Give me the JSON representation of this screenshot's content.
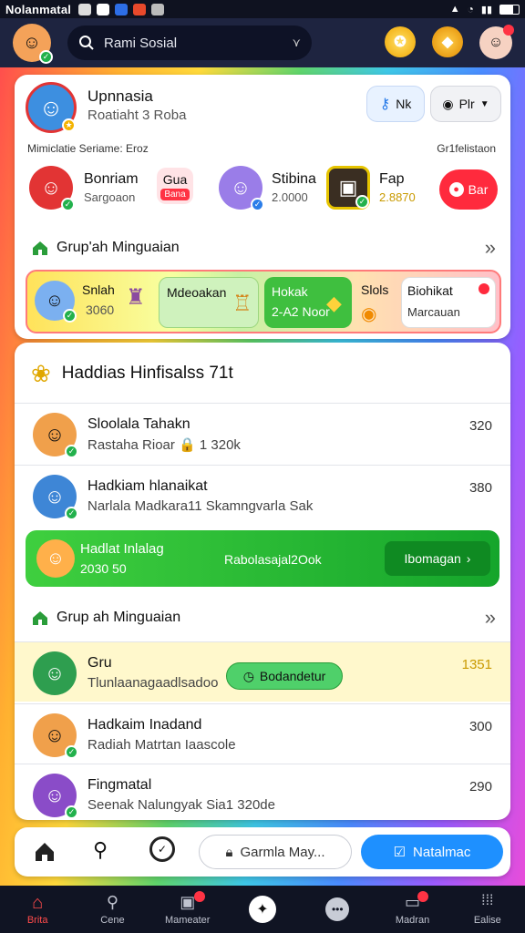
{
  "status_bar": {
    "carrier": "Nolanmatal"
  },
  "search": {
    "placeholder": "Rami Sosial"
  },
  "profile": {
    "name": "Upnnasia",
    "subtitle": "Roatiaht 3 Roba",
    "button1_label": "Nk",
    "button2_label": "Plr",
    "info_left": "Mimiclatie Seriame: Eroz",
    "info_right": "Gr1felistaon",
    "friends": [
      {
        "name": "Bonriam",
        "sub": "Sargoaon"
      },
      {
        "name": "Stibina",
        "sub": "2.0000"
      },
      {
        "name": "Fap",
        "sub": "2.8870"
      }
    ],
    "chip": {
      "label": "Gua",
      "tag": "Bana"
    },
    "red_pill_label": "Bar"
  },
  "section1": {
    "title": "Grup'ah Minguaian"
  },
  "promo": {
    "tiles": [
      {
        "title": "Snlah",
        "sub": "3060"
      },
      {
        "title": "Mdeoakan",
        "sub": ""
      },
      {
        "title": "Hokak",
        "sub": "2-A2 Noor"
      },
      {
        "title": "Slols",
        "sub": ""
      },
      {
        "title": "Biohikat",
        "sub": "Marcauan"
      }
    ]
  },
  "list": {
    "header": "Haddias Hinfisalss 71t",
    "rows": [
      {
        "title": "Sloolala Tahakn",
        "sub": "Rastaha Rioar 🔒 1 320k",
        "num": "320"
      },
      {
        "title": "Hadkiam hlanaikat",
        "sub": "Narlala Madkara11 Skamngvarla Sak",
        "num": "380"
      }
    ],
    "green_bar": {
      "title": "Hadlat Inlalag",
      "sub": "2030 50",
      "mid": "Rabolasajal2Ook",
      "action": "Ibomagan"
    },
    "section2_title": "Grup ah Minguaian",
    "rows2": [
      {
        "title": "Gru",
        "sub": "Tlunlaanagaadlsadoo",
        "pill": "Bodandetur",
        "num": "1351"
      },
      {
        "title": "Hadkaim Inadand",
        "sub": "Radiah Matrtan Iaascole",
        "num": "300"
      },
      {
        "title": "Fingmatal",
        "sub": "Seenak Nalungyak Sia1 320de",
        "num": "290"
      }
    ]
  },
  "bottom_actions": {
    "input_label": "Garmla May...",
    "primary_label": "Natalmac"
  },
  "nav": [
    {
      "label": "Brita"
    },
    {
      "label": "Cene"
    },
    {
      "label": "Mameater"
    },
    {
      "label": ""
    },
    {
      "label": ""
    },
    {
      "label": "Madran"
    },
    {
      "label": "Ealise"
    }
  ],
  "colors": {
    "accent_green": "#1faa2e",
    "accent_blue": "#1e90ff",
    "accent_red": "#ff2a3d"
  }
}
